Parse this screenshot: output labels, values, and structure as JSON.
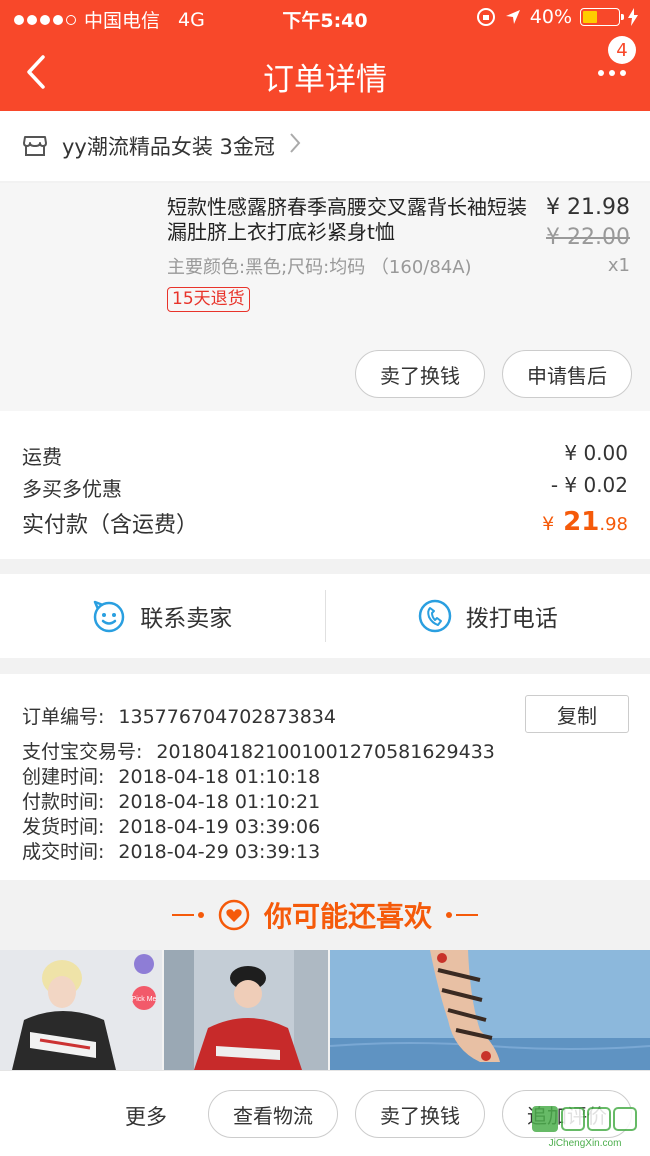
{
  "status_bar": {
    "carrier": "中国电信",
    "network": "4G",
    "time": "下午5:40",
    "battery": "40%",
    "battery_level": 0.4
  },
  "nav": {
    "title": "订单详情",
    "badge_count": "4"
  },
  "shop": {
    "name": "yy潮流精品女装 3金冠"
  },
  "product": {
    "title": "短款性感露脐春季高腰交叉露背长袖短装漏肚脐上衣打底衫紧身t恤",
    "spec": "主要颜色:黑色;尺码:均码 （160/84A)",
    "return_policy": "15天退货",
    "price": "¥ 21.98",
    "original_price": "¥ 22.00",
    "quantity": "x1",
    "buttons": {
      "sell": "卖了换钱",
      "after_sale": "申请售后"
    }
  },
  "fees": {
    "shipping_label": "运费",
    "shipping_value": "¥ 0.00",
    "discount_label": "多买多优惠",
    "discount_value": "- ¥ 0.02",
    "paid_label": "实付款（含运费）",
    "paid_currency": "¥",
    "paid_int": "21",
    "paid_dec": ".98"
  },
  "contact": {
    "seller": "联系卖家",
    "phone": "拨打电话"
  },
  "order_info": {
    "copy_label": "复制",
    "lines": [
      {
        "key": "订单编号:",
        "value": "135776704702873834"
      },
      {
        "key": "支付宝交易号:",
        "value": "2018041821001001270581629433"
      },
      {
        "key": "创建时间:",
        "value": "2018-04-18 01:10:18"
      },
      {
        "key": "付款时间:",
        "value": "2018-04-18 01:10:21"
      },
      {
        "key": "发货时间:",
        "value": "2018-04-19 03:39:06"
      },
      {
        "key": "成交时间:",
        "value": "2018-04-29 03:39:13"
      }
    ]
  },
  "recommend": {
    "title": "你可能还喜欢",
    "tile_labels": [
      "Pick Me"
    ]
  },
  "bottom_bar": {
    "more": "更多",
    "logistics": "查看物流",
    "sell": "卖了换钱",
    "review": "追加评价"
  },
  "watermark": {
    "text": "JiChengXin.com"
  },
  "colors": {
    "brand": "#f8482a",
    "price_accent": "#f55a0a",
    "return_badge": "#e8332a"
  }
}
